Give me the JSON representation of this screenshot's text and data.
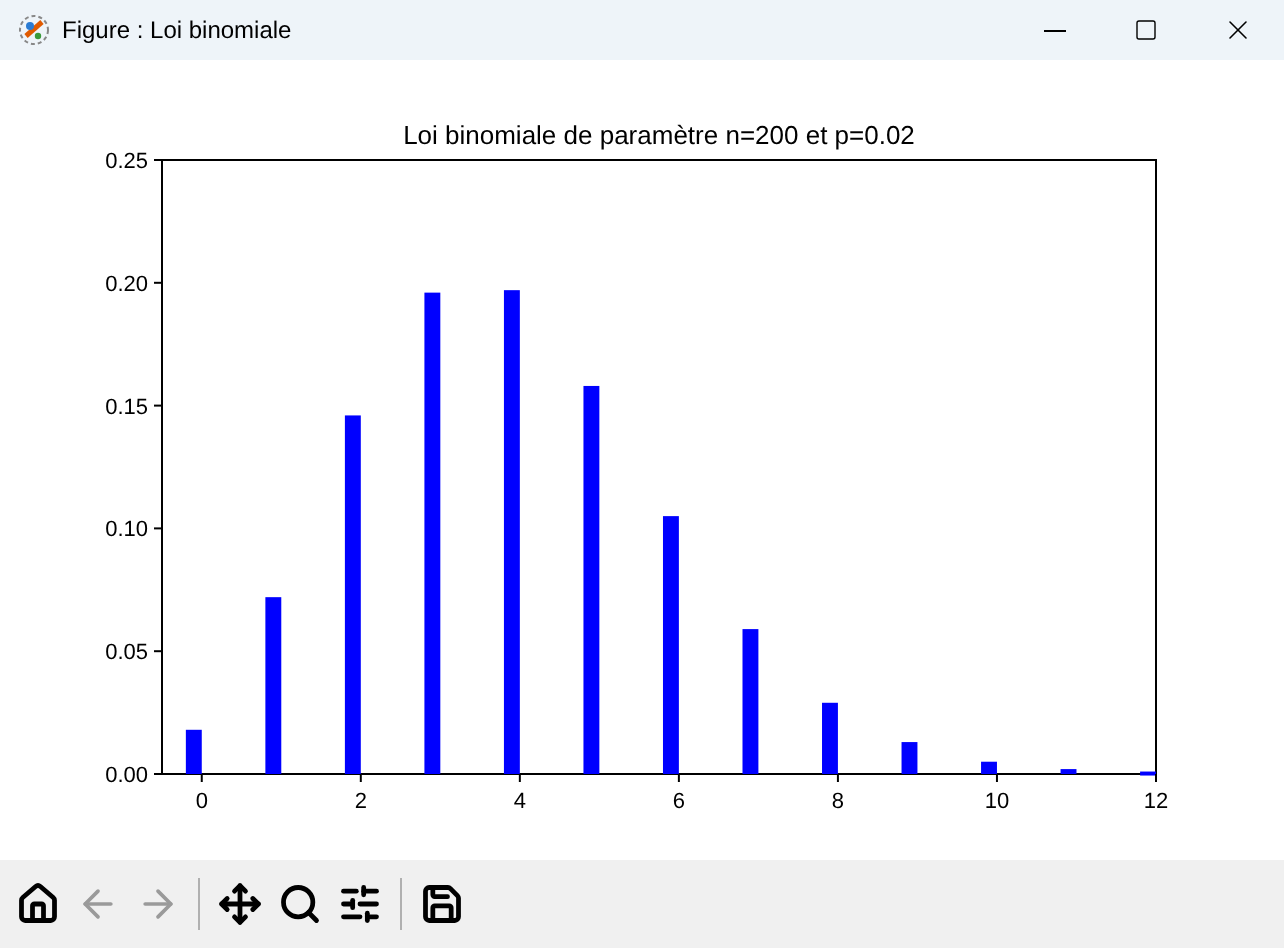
{
  "window": {
    "title": "Figure : Loi binomiale"
  },
  "figure": {
    "chart_data": {
      "type": "bar",
      "title": "Loi binomiale de paramètre n=200 et p=0.02",
      "x": [
        0,
        1,
        2,
        3,
        4,
        5,
        6,
        7,
        8,
        9,
        10,
        11,
        12
      ],
      "series": [
        {
          "color": "#0000ff",
          "values": [
            0.018,
            0.072,
            0.146,
            0.196,
            0.197,
            0.158,
            0.105,
            0.059,
            0.029,
            0.013,
            0.005,
            0.002,
            0.001
          ]
        }
      ],
      "xlim": [
        -0.5,
        12
      ],
      "ylim": [
        0,
        0.25
      ],
      "xticks": [
        {
          "value": 0,
          "label": "0"
        },
        {
          "value": 2,
          "label": "2"
        },
        {
          "value": 4,
          "label": "4"
        },
        {
          "value": 6,
          "label": "6"
        },
        {
          "value": 8,
          "label": "8"
        },
        {
          "value": 10,
          "label": "10"
        },
        {
          "value": 12,
          "label": "12"
        }
      ],
      "yticks": [
        {
          "value": 0,
          "label": "0.00"
        },
        {
          "value": 0.05,
          "label": "0.05"
        },
        {
          "value": 0.1,
          "label": "0.10"
        },
        {
          "value": 0.15,
          "label": "0.15"
        },
        {
          "value": 0.2,
          "label": "0.20"
        },
        {
          "value": 0.25,
          "label": "0.25"
        }
      ]
    }
  },
  "toolbar": [
    {
      "kind": "home",
      "disabled": false
    },
    {
      "kind": "back",
      "disabled": true
    },
    {
      "kind": "forward",
      "disabled": true
    },
    {
      "kind": "separator"
    },
    {
      "kind": "pan",
      "disabled": false
    },
    {
      "kind": "zoom",
      "disabled": false
    },
    {
      "kind": "subplots",
      "disabled": false
    },
    {
      "kind": "separator"
    },
    {
      "kind": "save",
      "disabled": false
    }
  ]
}
